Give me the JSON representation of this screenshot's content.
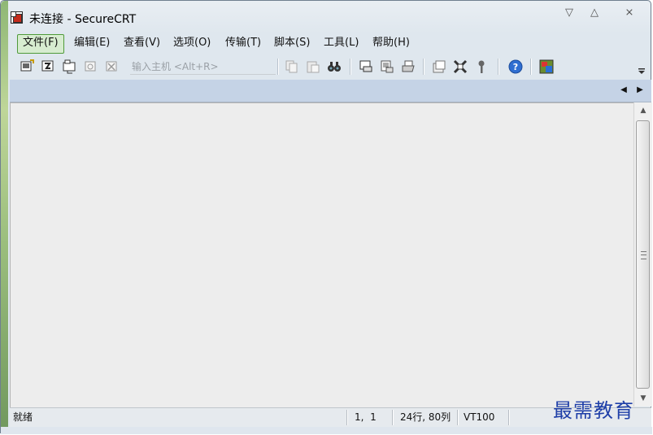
{
  "window": {
    "title": "未连接 - SecureCRT",
    "controls": {
      "minimize_icon": "▽",
      "maximize_icon": "△",
      "close_icon": "⨯"
    }
  },
  "menu": {
    "items": [
      {
        "label": "文件(F)"
      },
      {
        "label": "编辑(E)"
      },
      {
        "label": "查看(V)"
      },
      {
        "label": "选项(O)"
      },
      {
        "label": "传输(T)"
      },
      {
        "label": "脚本(S)"
      },
      {
        "label": "工具(L)"
      },
      {
        "label": "帮助(H)"
      }
    ],
    "active_index": 0
  },
  "toolbar": {
    "host_input_placeholder": "输入主机 <Alt+R>",
    "icons": [
      "connect-icon",
      "quick-connect-icon",
      "connect-in-tab-icon",
      "reconnect-icon",
      "disconnect-icon",
      "copy-icon",
      "paste-icon",
      "find-icon",
      "print-screen-icon",
      "print-selection-icon",
      "print-icon",
      "session-options-icon",
      "global-options-icon",
      "keymap-icon",
      "help-icon",
      "sftp-icon"
    ]
  },
  "tabbar": {
    "scroll_left_icon": "◀",
    "scroll_right_icon": "▶"
  },
  "scrollbar": {
    "up_icon": "▲",
    "down_icon": "▼"
  },
  "statusbar": {
    "status": "就绪",
    "cursor_pos": "1,  1",
    "size": "24行, 80列",
    "emulation": "VT100"
  },
  "watermark": "最需教育"
}
